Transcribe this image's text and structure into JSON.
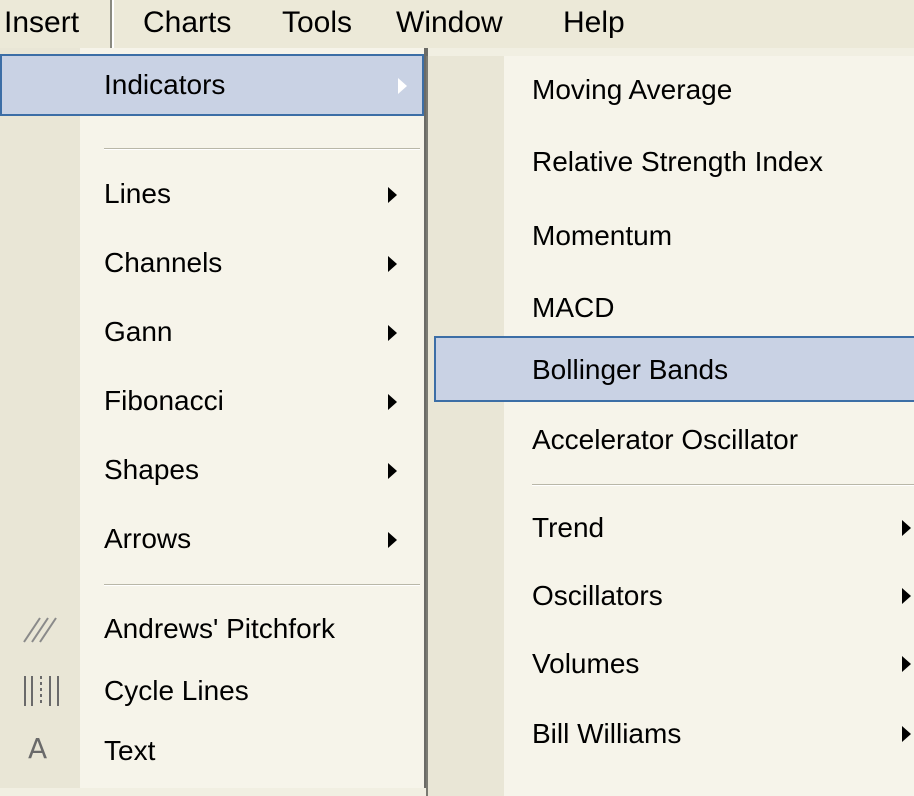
{
  "menubar": {
    "insert": "Insert",
    "charts": "Charts",
    "tools": "Tools",
    "window": "Window",
    "help": "Help"
  },
  "insert_menu": {
    "items": [
      {
        "label": "Indicators",
        "submenu": true,
        "highlighted": true
      },
      {
        "label": "Lines",
        "submenu": true
      },
      {
        "label": "Channels",
        "submenu": true
      },
      {
        "label": "Gann",
        "submenu": true
      },
      {
        "label": "Fibonacci",
        "submenu": true
      },
      {
        "label": "Shapes",
        "submenu": true
      },
      {
        "label": "Arrows",
        "submenu": true
      },
      {
        "label": "Andrews' Pitchfork",
        "icon": "pitchfork-icon"
      },
      {
        "label": "Cycle Lines",
        "icon": "cycle-lines-icon"
      },
      {
        "label": "Text",
        "icon": "text-icon"
      }
    ]
  },
  "indicators_menu": {
    "items": [
      {
        "label": "Moving Average"
      },
      {
        "label": "Relative Strength Index"
      },
      {
        "label": "Momentum"
      },
      {
        "label": "MACD"
      },
      {
        "label": "Bollinger Bands",
        "highlighted": true
      },
      {
        "label": "Accelerator Oscillator"
      },
      {
        "label": "Trend",
        "submenu": true
      },
      {
        "label": "Oscillators",
        "submenu": true
      },
      {
        "label": "Volumes",
        "submenu": true
      },
      {
        "label": "Bill Williams",
        "submenu": true
      }
    ]
  },
  "colors": {
    "highlight_fill": "#c9d2e4",
    "highlight_border": "#3c6ea6",
    "menu_bg": "#f6f4ea",
    "menubar_bg": "#ece9d8"
  }
}
